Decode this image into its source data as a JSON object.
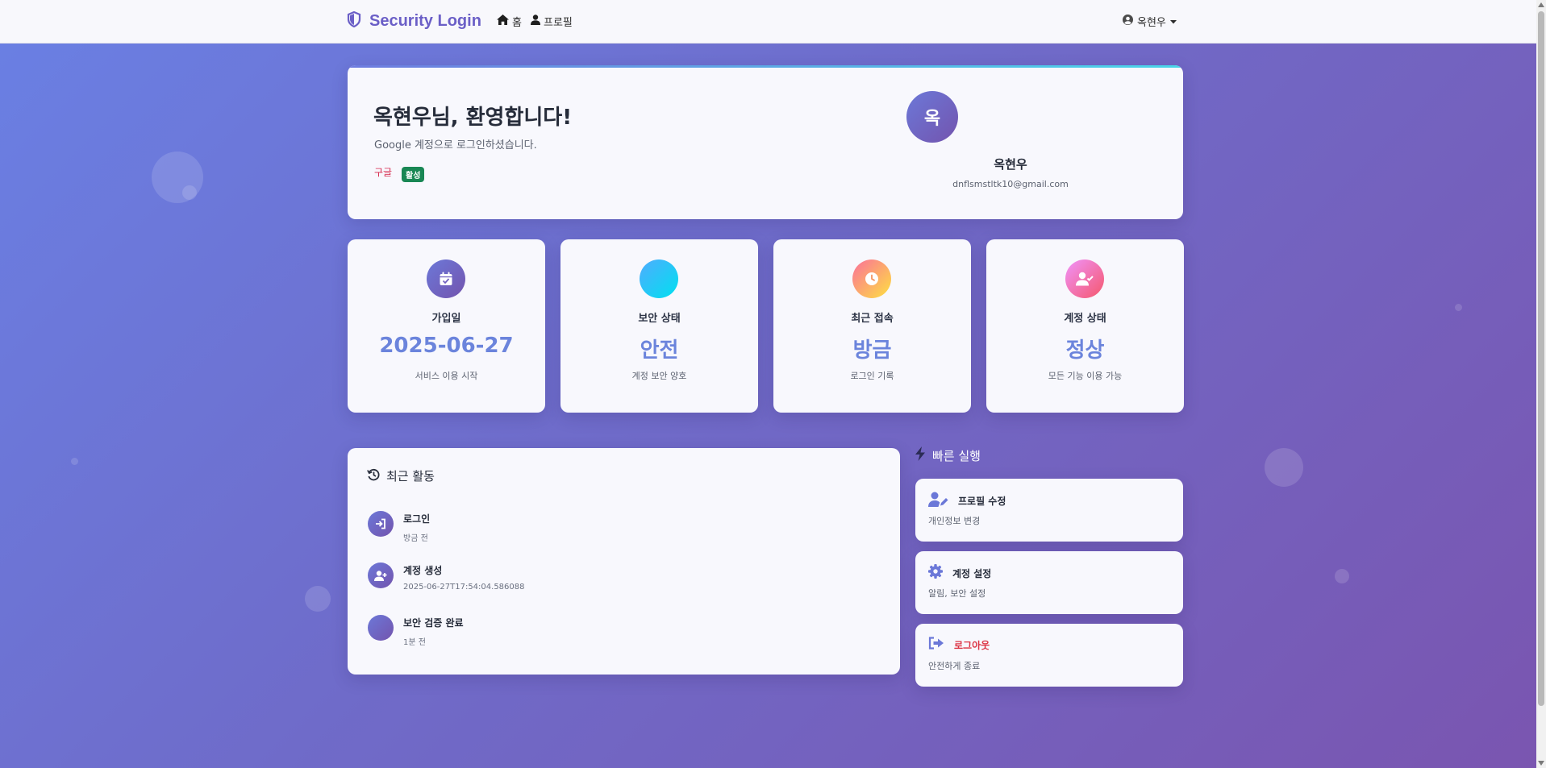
{
  "navbar": {
    "brand": "Security Login",
    "links": [
      {
        "label": "홈",
        "icon": "home-icon"
      },
      {
        "label": "프로필",
        "icon": "user-icon"
      }
    ],
    "user_menu": "옥현우"
  },
  "welcome": {
    "title": "옥현우님, 환영합니다!",
    "subtitle": "Google 계정으로 로그인하셨습니다.",
    "provider": "구글",
    "status_badge": "활성",
    "avatar_initial": "옥",
    "name": "옥현우",
    "email": "dnflsmstltk10@gmail.com"
  },
  "stats": [
    {
      "label": "가입일",
      "value": "2025-06-27",
      "desc": "서비스 이용 시작",
      "icon": "calendar-check-icon"
    },
    {
      "label": "보안 상태",
      "value": "안전",
      "desc": "계정 보안 양호",
      "icon": "shield-icon"
    },
    {
      "label": "최근 접속",
      "value": "방금",
      "desc": "로그인 기록",
      "icon": "clock-icon"
    },
    {
      "label": "계정 상태",
      "value": "정상",
      "desc": "모든 기능 이용 가능",
      "icon": "user-check-icon"
    }
  ],
  "activity": {
    "title": "최근 활동",
    "items": [
      {
        "name": "로그인",
        "time": "방금 전",
        "icon": "sign-in-icon"
      },
      {
        "name": "계정 생성",
        "time": "2025-06-27T17:54:04.586088",
        "icon": "user-plus-icon"
      },
      {
        "name": "보안 검증 완료",
        "time": "1분 전",
        "icon": "shield-check-icon"
      }
    ]
  },
  "quick_actions": {
    "title": "빠른 실행",
    "items": [
      {
        "name": "프로필 수정",
        "desc": "개인정보 변경",
        "icon": "user-edit-icon"
      },
      {
        "name": "계정 설정",
        "desc": "알림, 보안 설정",
        "icon": "gear-icon"
      },
      {
        "name": "로그아웃",
        "desc": "안전하게 종료",
        "icon": "logout-icon"
      }
    ]
  },
  "colors": {
    "brand": "#6b5fc7",
    "accent": "#6b84dc",
    "logout": "#dc3545",
    "badge": "#198754"
  }
}
